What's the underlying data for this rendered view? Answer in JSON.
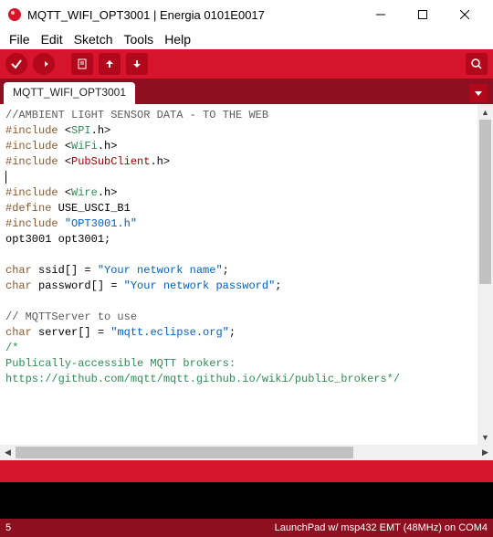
{
  "window": {
    "title": "MQTT_WIFI_OPT3001 | Energia 0101E0017"
  },
  "menu": {
    "file": "File",
    "edit": "Edit",
    "sketch": "Sketch",
    "tools": "Tools",
    "help": "Help"
  },
  "tab": {
    "name": "MQTT_WIFI_OPT3001"
  },
  "code": {
    "c1": "//AMBIENT LIGHT SENSOR DATA - TO THE WEB",
    "inc": "#include",
    "def": "#define",
    "spi": "SPI",
    "wifi": "WiFi",
    "pubsub": "PubSubClient",
    "dot_h": ".h>",
    "lt": "<",
    "wire": "Wire",
    "usci": "USE_USCI_B1",
    "opt_h": "\"OPT3001.h\"",
    "opt_decl_t": "opt3001",
    "opt_decl_v": " opt3001;",
    "char": "char",
    "ssid": " ssid[] = ",
    "ssid_v": "\"Your network name\"",
    "pass": " password[] = ",
    "pass_v": "\"Your network password\"",
    "semi": ";",
    "c2": "// MQTTServer to use",
    "server": " server[] = ",
    "server_v": "\"mqtt.eclipse.org\"",
    "c3": "/*",
    "c4": "Publically-accessible MQTT brokers:",
    "c5": "https://github.com/mqtt/mqtt.github.io/wiki/public_brokers*/"
  },
  "status": {
    "line": "5",
    "board": "LaunchPad w/ msp432 EMT (48MHz) on COM4"
  }
}
